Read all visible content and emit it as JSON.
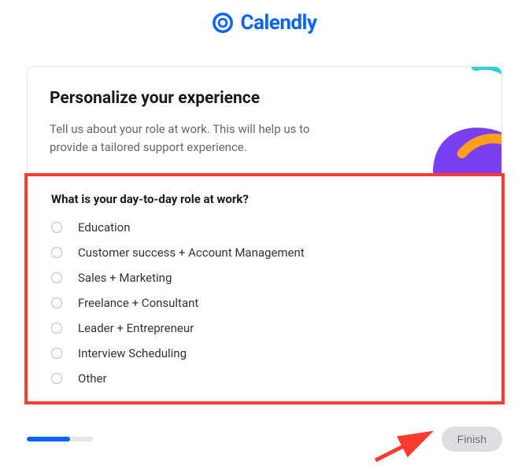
{
  "header": {
    "brand": "Calendly"
  },
  "card": {
    "title": "Personalize your experience",
    "subtitle": "Tell us about your role at work. This will help us to provide a tailored support experience."
  },
  "question": "What is your day-to-day role at work?",
  "options": [
    {
      "label": "Education"
    },
    {
      "label": "Customer success + Account Management"
    },
    {
      "label": "Sales + Marketing"
    },
    {
      "label": "Freelance + Consultant"
    },
    {
      "label": "Leader + Entrepreneur"
    },
    {
      "label": "Interview Scheduling"
    },
    {
      "label": "Other"
    }
  ],
  "footer": {
    "finish_label": "Finish"
  }
}
